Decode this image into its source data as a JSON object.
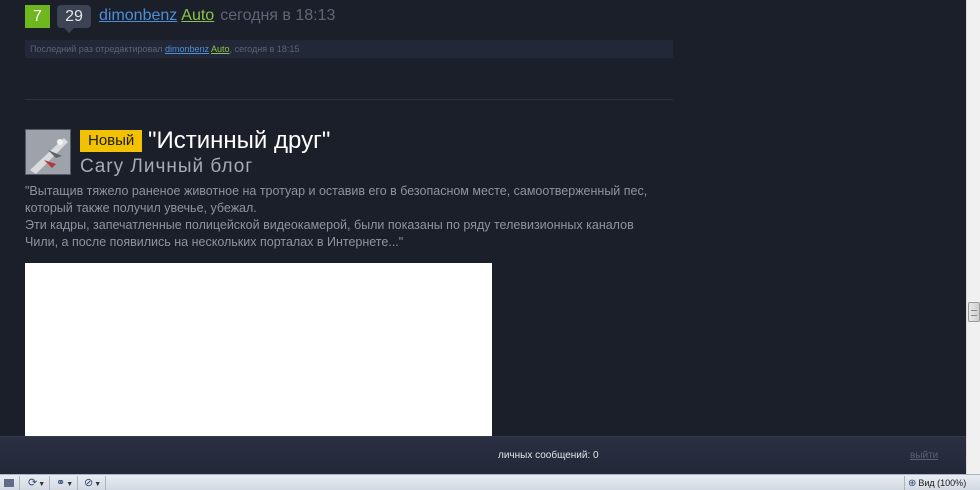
{
  "meta": {
    "rating": "7",
    "comments": "29",
    "author": "dimonbenz",
    "blog": "Auto",
    "date": "сегодня в 18:13"
  },
  "edited": {
    "prefix": "Последний раз отредактировал",
    "author": "dimonbenz",
    "blog": "Auto",
    "suffix": ", сегодня в 18:15"
  },
  "post": {
    "badge": "Новый",
    "title": "\"Истинный друг\"",
    "blog_line": "Cary Личный блог",
    "excerpt_1": "\"Вытащив тяжело раненое животное на тротуар и оставив его в безопасном месте, самоотверженный пес, который также получил увечье, убежал.",
    "excerpt_2": "Эти кадры, запечатленные полицейской видеокамерой, были показаны по ряду телевизионных каналов Чили, а после появились на нескольких порталах в Интернете...\""
  },
  "userbar": {
    "messages": "личных сообщений: 0",
    "logout": "выйти"
  },
  "statusbar": {
    "zoom": "Вид (100%)"
  }
}
